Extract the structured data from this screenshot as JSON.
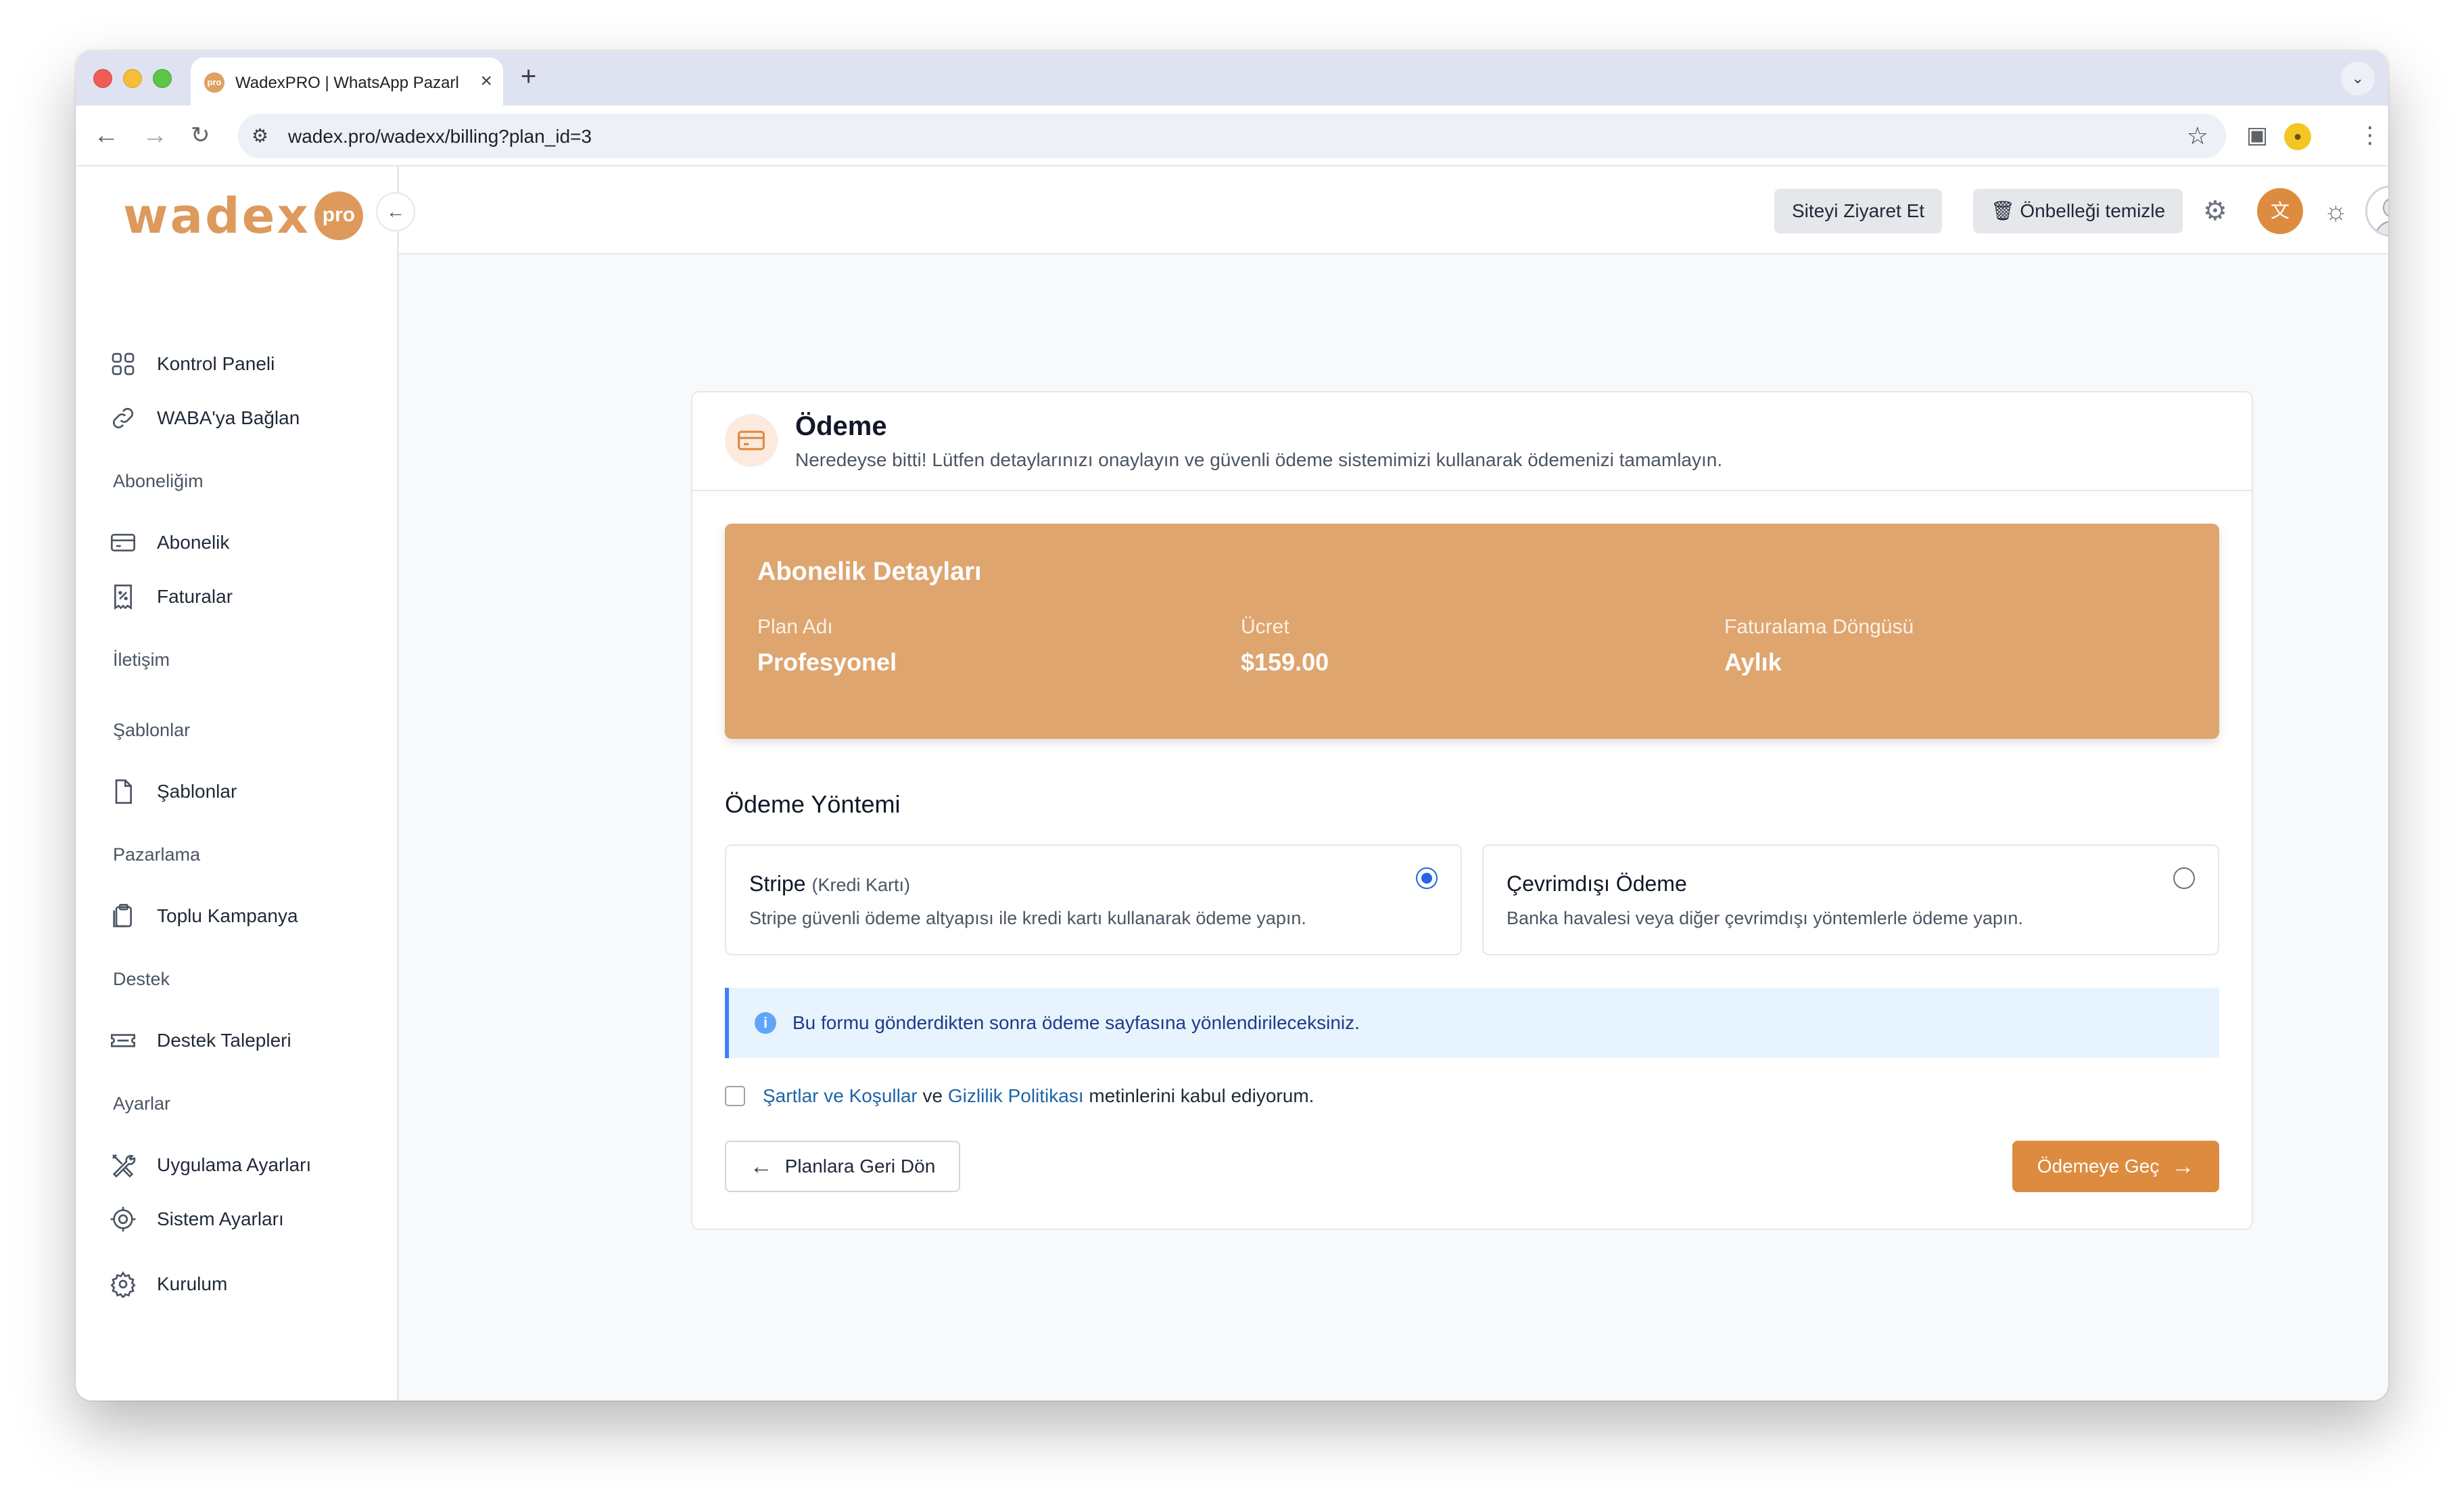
{
  "browser": {
    "tab_title": "WadexPRO | WhatsApp Pazarlama",
    "favicon_text": "pro",
    "url": "wadex.pro/wadexx/billing?plan_id=3"
  },
  "sidebar": {
    "logo": {
      "word": "wadex",
      "badge": "pro"
    },
    "items": [
      {
        "label": "Kontrol Paneli",
        "icon": "grid-icon"
      },
      {
        "label": "WABA'ya Bağlan",
        "icon": "link-icon"
      },
      {
        "label": "Abonelik",
        "icon": "card-icon"
      },
      {
        "label": "Faturalar",
        "icon": "invoice-icon"
      },
      {
        "label": "Şablonlar",
        "icon": "document-icon"
      },
      {
        "label": "Toplu Kampanya",
        "icon": "clipboard-icon"
      },
      {
        "label": "Destek Talepleri",
        "icon": "ticket-icon"
      },
      {
        "label": "Uygulama Ayarları",
        "icon": "tools-icon"
      },
      {
        "label": "Sistem Ayarları",
        "icon": "cog-icon"
      },
      {
        "label": "Kurulum",
        "icon": "settings-icon"
      }
    ],
    "sections": [
      "Aboneliğim",
      "İletişim",
      "Şablonlar",
      "Pazarlama",
      "Destek",
      "Ayarlar"
    ]
  },
  "header": {
    "visit_site": "Siteyi Ziyaret Et",
    "clear_cache": "Önbelleği temizle"
  },
  "payment": {
    "title": "Ödeme",
    "subtitle": "Neredeyse bitti! Lütfen detaylarınızı onaylayın ve güvenli ödeme sistemimizi kullanarak ödemenizi tamamlayın.",
    "details": {
      "title": "Abonelik Detayları",
      "plan_label": "Plan Adı",
      "plan_value": "Profesyonel",
      "price_label": "Ücret",
      "price_value": "$159.00",
      "cycle_label": "Faturalama Döngüsü",
      "cycle_value": "Aylık"
    },
    "method_title": "Ödeme Yöntemi",
    "methods": [
      {
        "name": "Stripe",
        "sub": "(Kredi Kartı)",
        "desc": "Stripe güvenli ödeme altyapısı ile kredi kartı kullanarak ödeme yapın.",
        "selected": true
      },
      {
        "name": "Çevrimdışı Ödeme",
        "sub": "",
        "desc": "Banka havalesi veya diğer çevrimdışı yöntemlerle ödeme yapın.",
        "selected": false
      }
    ],
    "info": "Bu formu gönderdikten sonra ödeme sayfasına yönlendirileceksiniz.",
    "terms": {
      "link1": "Şartlar ve Koşullar",
      "and": "ve",
      "link2": "Gizlilik Politikası",
      "rest": "metinlerini kabul ediyorum.",
      "checked": false
    },
    "back_button": "Planlara Geri Dön",
    "pay_button": "Ödemeye Geç"
  },
  "colors": {
    "accent": "#dd8b3f",
    "details_bg": "#dea56f",
    "link": "#1d64a8",
    "radio_selected": "#2563eb"
  }
}
